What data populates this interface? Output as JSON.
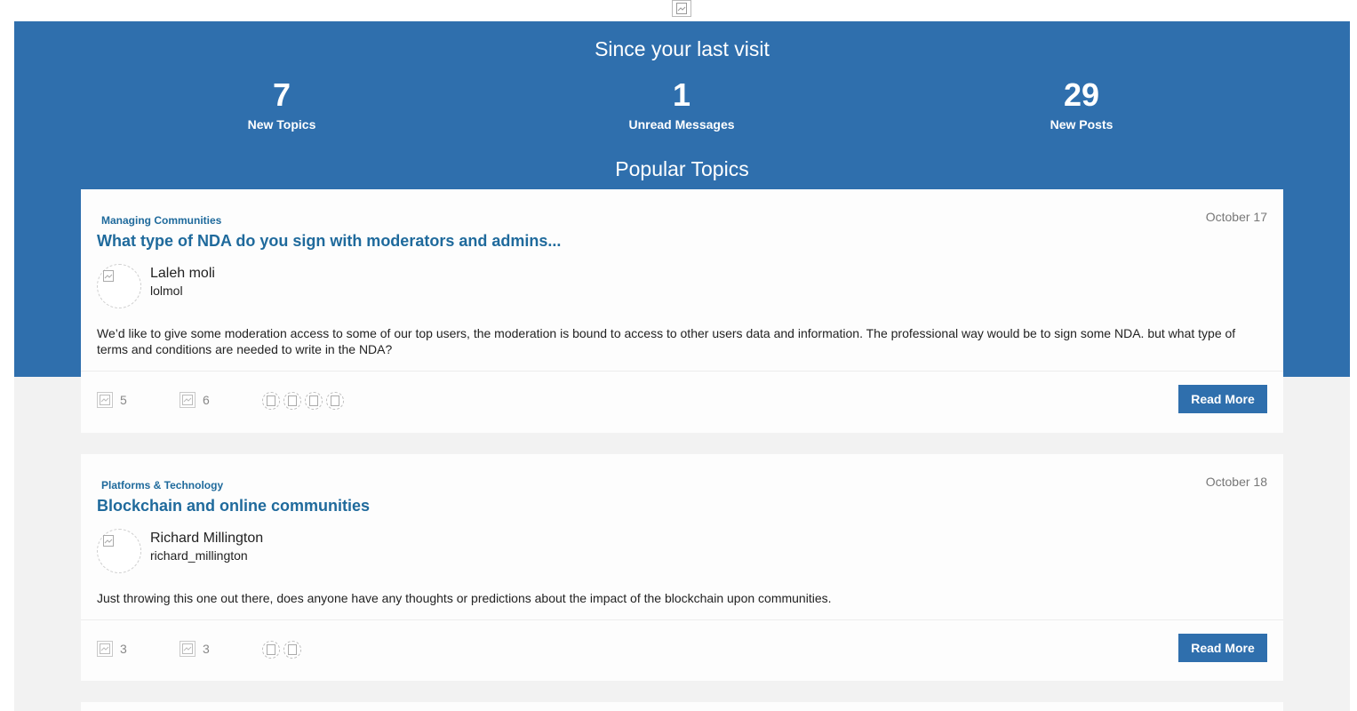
{
  "hero": {
    "title": "Since your last visit",
    "stats": [
      {
        "value": "7",
        "label": "New Topics"
      },
      {
        "value": "1",
        "label": "Unread Messages"
      },
      {
        "value": "29",
        "label": "New Posts"
      }
    ],
    "popular_title": "Popular Topics"
  },
  "topics": [
    {
      "category": "Managing Communities",
      "date": "October 17",
      "title": "What type of NDA do you sign with moderators and admins...",
      "author_name": "Laleh moli",
      "author_username": "lolmol",
      "excerpt": "We’d like to give some moderation access to some of our top users, the moderation is bound to access to other users data and information. The professional way would be to sign some NDA. but what type of terms and conditions are needed to write in the NDA?",
      "replies": "5",
      "likes": "6",
      "participants_shown": 4,
      "read_more": "Read More"
    },
    {
      "category": "Platforms & Technology",
      "date": "October 18",
      "title": "Blockchain and online communities",
      "author_name": "Richard Millington",
      "author_username": "richard_millington",
      "excerpt": "Just throwing this one out there, does anyone have any thoughts or predictions about the impact of the blockchain upon communities.",
      "replies": "3",
      "likes": "3",
      "participants_shown": 2,
      "read_more": "Read More"
    }
  ],
  "icons": {
    "logo": "broken-image-icon",
    "avatar": "broken-image-icon",
    "replies": "reply-count-icon",
    "likes": "like-count-icon",
    "participant": "participant-avatar-icon"
  },
  "colors": {
    "hero_bg": "#2f6fad",
    "link": "#1f6a9c",
    "button_bg": "#2f6fad",
    "page_bg": "#f2f2f2"
  }
}
